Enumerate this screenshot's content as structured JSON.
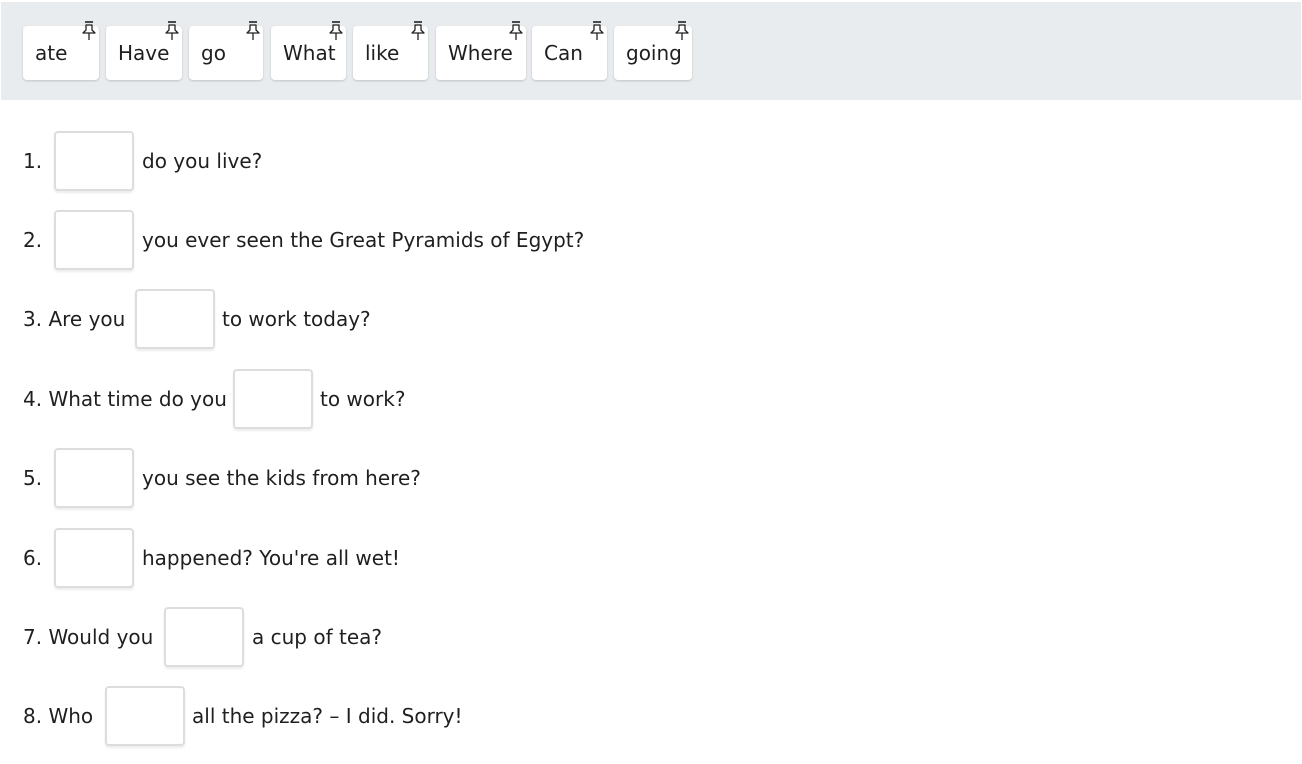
{
  "word_bank": {
    "chips": [
      {
        "label": "ate",
        "icon": "pin-icon"
      },
      {
        "label": "Have",
        "icon": "pin-icon"
      },
      {
        "label": "go",
        "icon": "pin-icon"
      },
      {
        "label": "What",
        "icon": "pin-icon"
      },
      {
        "label": "like",
        "icon": "pin-icon"
      },
      {
        "label": "Where",
        "icon": "pin-icon"
      },
      {
        "label": "Can",
        "icon": "pin-icon"
      },
      {
        "label": "going",
        "icon": "pin-icon"
      }
    ]
  },
  "questions": [
    {
      "before": "1.",
      "after": "do you live?",
      "answer": ""
    },
    {
      "before": "2.",
      "after": "you ever seen the Great Pyramids of Egypt?",
      "answer": ""
    },
    {
      "before": "3. Are you",
      "after": "to work today?",
      "answer": ""
    },
    {
      "before": "4. What time do you",
      "after": "to work?",
      "answer": ""
    },
    {
      "before": "5.",
      "after": "you see the kids from here?",
      "answer": ""
    },
    {
      "before": "6.",
      "after": "happened? You're all wet!",
      "answer": ""
    },
    {
      "before": "7. Would you",
      "after": "a cup of tea?",
      "answer": ""
    },
    {
      "before": "8. Who",
      "after": "all the pizza? – I did. Sorry!",
      "answer": ""
    }
  ]
}
